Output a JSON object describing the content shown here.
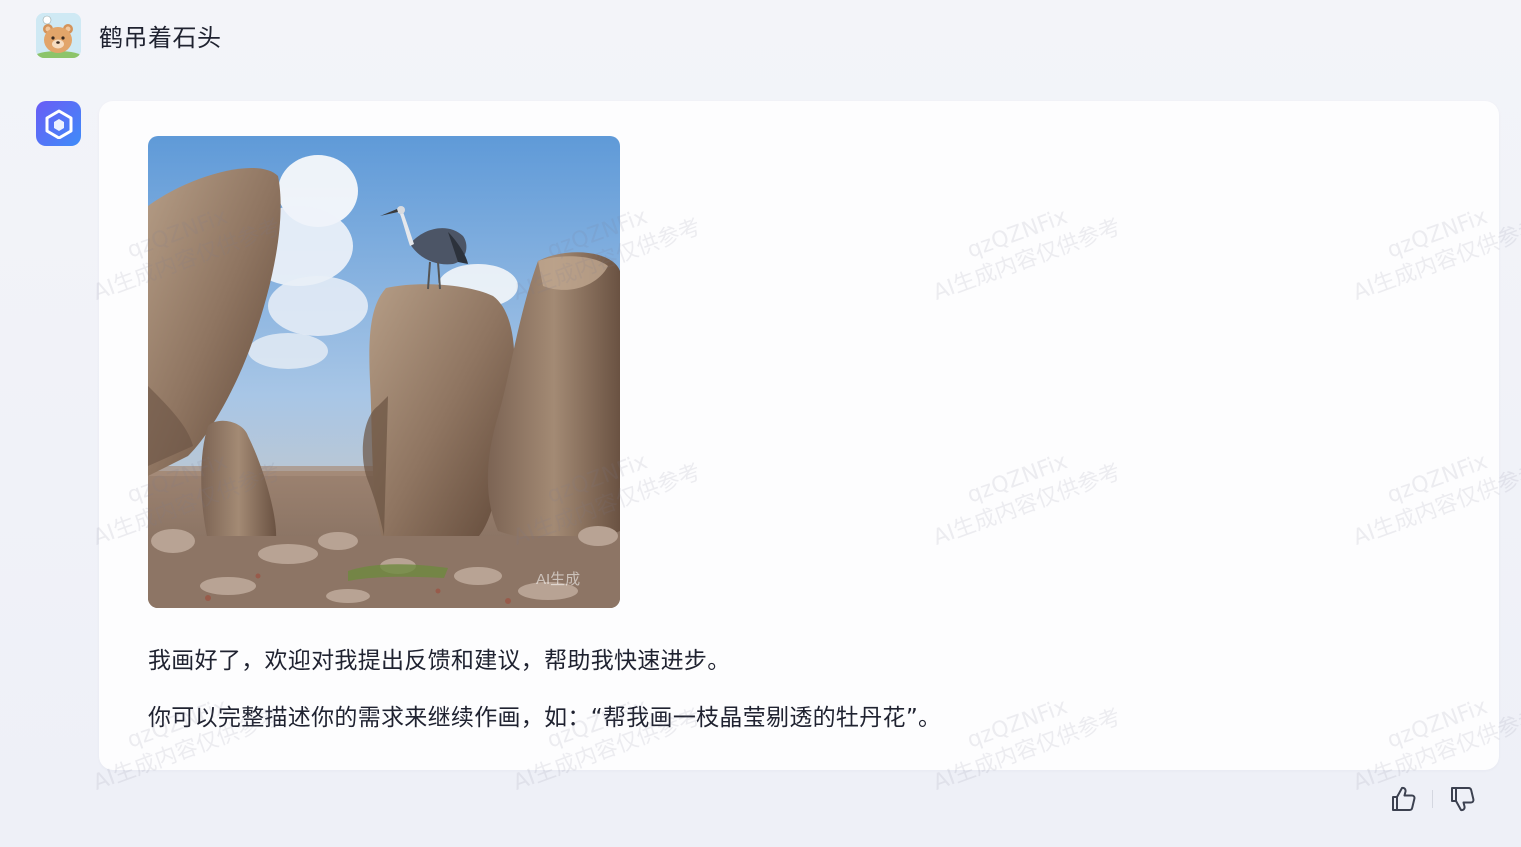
{
  "user": {
    "avatar_icon": "bear-avatar-icon",
    "message": "鹤吊着石头"
  },
  "bot": {
    "avatar_icon": "cube-logo-icon",
    "image_alt": "鹤站在巨石上的生成图片",
    "image_badge": "AI生成",
    "reply_line_1": "我画好了，欢迎对我提出反馈和建议，帮助我快速进步。",
    "reply_line_2": "你可以完整描述你的需求来继续作画，如：“帮我画一枝晶莹剔透的牡丹花”。"
  },
  "watermark": {
    "line1": "qzQZNFix",
    "line2": "AI生成内容仅供参考"
  },
  "feedback": {
    "like_icon": "thumbs-up-icon",
    "dislike_icon": "thumbs-down-icon"
  },
  "colors": {
    "accent_gradient_start": "#6a5cf6",
    "accent_gradient_end": "#3f8cf8",
    "text": "#1f2230"
  }
}
